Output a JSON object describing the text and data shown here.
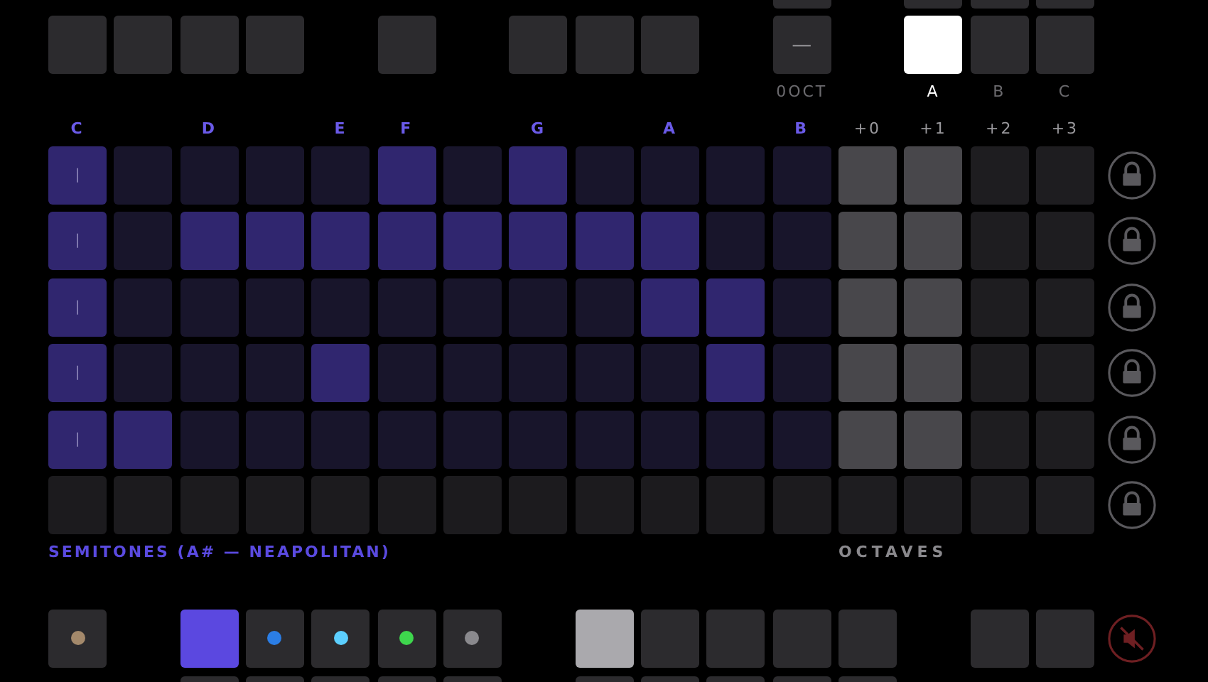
{
  "octave_shift": {
    "glyph": "—",
    "label": "0OCT"
  },
  "keys": [
    {
      "label": "A",
      "selected": true
    },
    {
      "label": "B",
      "selected": false
    },
    {
      "label": "C",
      "selected": false
    }
  ],
  "note_labels": [
    "C",
    "D",
    "E",
    "F",
    "G",
    "A",
    "B"
  ],
  "octave_labels": [
    "+0",
    "+1",
    "+2",
    "+3"
  ],
  "grid": {
    "rows": [
      {
        "enabled": true,
        "semitones": [
          {
            "on": true,
            "marker": "|"
          },
          {
            "on": false
          },
          {
            "on": false
          },
          {
            "on": false
          },
          {
            "on": false
          },
          {
            "on": true
          },
          {
            "on": false
          },
          {
            "on": true
          },
          {
            "on": false
          },
          {
            "on": false
          },
          {
            "on": false
          },
          {
            "on": false
          }
        ],
        "octaves": [
          {
            "on": true
          },
          {
            "on": true
          },
          {
            "on": false
          },
          {
            "on": false
          }
        ]
      },
      {
        "enabled": true,
        "semitones": [
          {
            "on": true,
            "marker": "|"
          },
          {
            "on": false
          },
          {
            "on": true
          },
          {
            "on": true
          },
          {
            "on": true
          },
          {
            "on": true
          },
          {
            "on": true
          },
          {
            "on": true
          },
          {
            "on": true
          },
          {
            "on": true
          },
          {
            "on": false
          },
          {
            "on": false
          }
        ],
        "octaves": [
          {
            "on": true
          },
          {
            "on": true
          },
          {
            "on": false
          },
          {
            "on": false
          }
        ]
      },
      {
        "enabled": true,
        "semitones": [
          {
            "on": true,
            "marker": "|"
          },
          {
            "on": false
          },
          {
            "on": false
          },
          {
            "on": false
          },
          {
            "on": false
          },
          {
            "on": false
          },
          {
            "on": false
          },
          {
            "on": false
          },
          {
            "on": false
          },
          {
            "on": true
          },
          {
            "on": true
          },
          {
            "on": false
          }
        ],
        "octaves": [
          {
            "on": true
          },
          {
            "on": true
          },
          {
            "on": false
          },
          {
            "on": false
          }
        ]
      },
      {
        "enabled": true,
        "semitones": [
          {
            "on": true,
            "marker": "|"
          },
          {
            "on": false
          },
          {
            "on": false
          },
          {
            "on": false
          },
          {
            "on": true
          },
          {
            "on": false
          },
          {
            "on": false
          },
          {
            "on": false
          },
          {
            "on": false
          },
          {
            "on": false
          },
          {
            "on": true
          },
          {
            "on": false
          }
        ],
        "octaves": [
          {
            "on": true
          },
          {
            "on": true
          },
          {
            "on": false
          },
          {
            "on": false
          }
        ]
      },
      {
        "enabled": true,
        "semitones": [
          {
            "on": true,
            "marker": "|"
          },
          {
            "on": true
          },
          {
            "on": false
          },
          {
            "on": false
          },
          {
            "on": false
          },
          {
            "on": false
          },
          {
            "on": false
          },
          {
            "on": false
          },
          {
            "on": false
          },
          {
            "on": false
          },
          {
            "on": false
          },
          {
            "on": false
          }
        ],
        "octaves": [
          {
            "on": true
          },
          {
            "on": true
          },
          {
            "on": false
          },
          {
            "on": false
          }
        ]
      },
      {
        "enabled": false,
        "semitones": [
          {
            "on": false
          },
          {
            "on": false
          },
          {
            "on": false
          },
          {
            "on": false
          },
          {
            "on": false
          },
          {
            "on": false
          },
          {
            "on": false
          },
          {
            "on": false
          },
          {
            "on": false
          },
          {
            "on": false
          },
          {
            "on": false
          },
          {
            "on": false
          }
        ],
        "octaves": [
          {
            "on": false
          },
          {
            "on": false
          },
          {
            "on": false
          },
          {
            "on": false
          }
        ]
      }
    ]
  },
  "semitones_label": "SEMITONES (A# — NEAPOLITAN)",
  "octaves_label": "OCTAVES",
  "swatch": {
    "color": "#a4896b"
  },
  "tracks": [
    {
      "selected": true
    },
    {
      "selected": false,
      "color": "#2b7ee6"
    },
    {
      "selected": false,
      "color": "#5ccfff"
    },
    {
      "selected": false,
      "color": "#3ed64d"
    },
    {
      "selected": false,
      "color": "#8a898d"
    }
  ],
  "steps": [
    {
      "selected": true
    },
    {
      "selected": false
    },
    {
      "selected": false
    },
    {
      "selected": false
    },
    {
      "selected": false
    }
  ],
  "mute": {
    "muted": true
  }
}
